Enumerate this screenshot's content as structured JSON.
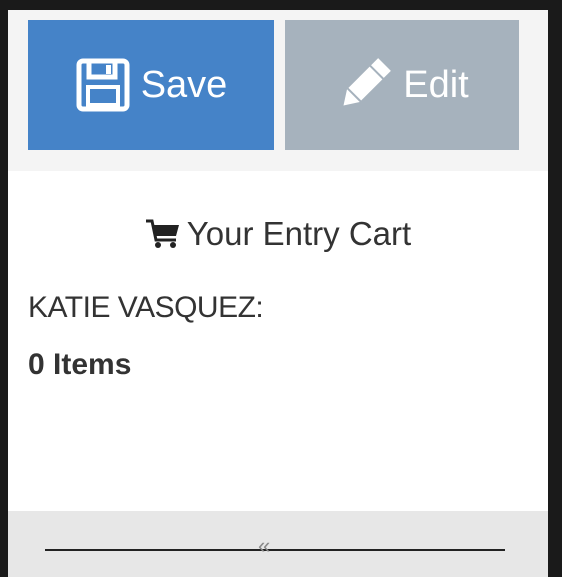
{
  "toolbar": {
    "save_label": "Save",
    "edit_label": "Edit"
  },
  "cart": {
    "title": "Your Entry Cart",
    "customer_name": "KATIE VASQUEZ:",
    "item_count": "0 Items"
  },
  "icons": {
    "save": "floppy-disk-icon",
    "edit": "pencil-icon",
    "cart": "shopping-cart-icon",
    "collapse": "double-chevron-left-icon"
  },
  "colors": {
    "save_button": "#4583c8",
    "edit_button": "#a6b2bd",
    "background": "#1a1a1a",
    "panel": "#ffffff",
    "footer": "#e7e7e7",
    "text": "#333333"
  }
}
